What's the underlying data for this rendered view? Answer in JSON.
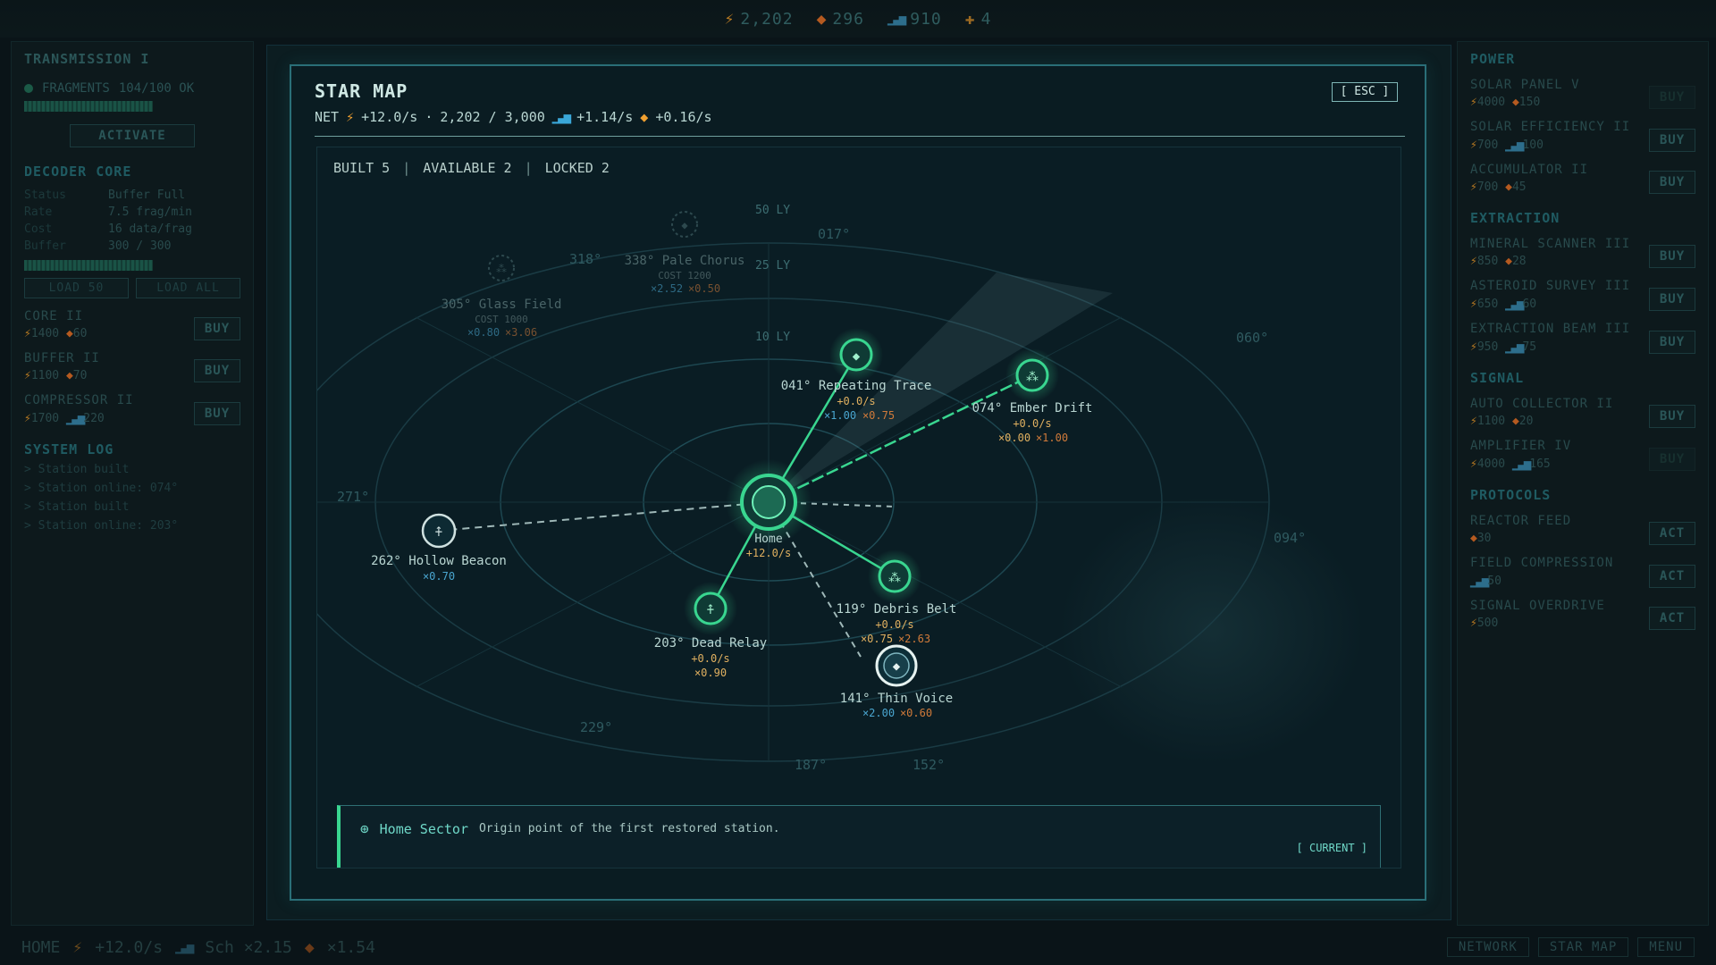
{
  "topbar": {
    "energy": "2,202",
    "minerals": "296",
    "signal": "910",
    "fragments": "4"
  },
  "left": {
    "title": "TRANSMISSION I",
    "fragments_label": "FRAGMENTS",
    "fragments_value": "104/100 OK",
    "activate": "ACTIVATE",
    "decoder_title": "DECODER CORE",
    "decoder": [
      {
        "k": "Status",
        "v": "Buffer Full"
      },
      {
        "k": "Rate",
        "v": "7.5 frag/min"
      },
      {
        "k": "Cost",
        "v": "16 data/frag"
      },
      {
        "k": "Buffer",
        "v": "300 / 300"
      }
    ],
    "load50": "LOAD 50",
    "loadall": "LOAD ALL",
    "shop": [
      {
        "name": "CORE II",
        "c1": "1400",
        "c2": "60",
        "buy": "BUY"
      },
      {
        "name": "BUFFER II",
        "c1": "1100",
        "c2": "70",
        "buy": "BUY"
      },
      {
        "name": "COMPRESSOR II",
        "c1": "1700",
        "c2": "220",
        "buy": "BUY"
      }
    ],
    "log_title": "SYSTEM LOG",
    "log": [
      "> Station built",
      "> Station online: 074°",
      "> Station built",
      "> Station online: 203°"
    ]
  },
  "right": {
    "power_title": "POWER",
    "power": [
      {
        "name": "SOLAR PANEL V",
        "c1": "4000",
        "c2": "150",
        "buy": "BUY",
        "disabled": true
      },
      {
        "name": "SOLAR EFFICIENCY II",
        "c1": "700",
        "c2": "100",
        "buy": "BUY",
        "disabled": false
      },
      {
        "name": "ACCUMULATOR II",
        "c1": "700",
        "c2": "45",
        "buy": "BUY",
        "disabled": false
      }
    ],
    "extraction_title": "EXTRACTION",
    "extraction": [
      {
        "name": "MINERAL SCANNER III",
        "c1": "850",
        "c2": "28",
        "buy": "BUY"
      },
      {
        "name": "ASTEROID SURVEY III",
        "c1": "650",
        "c2": "60",
        "buy": "BUY"
      },
      {
        "name": "EXTRACTION BEAM III",
        "c1": "950",
        "c2": "75",
        "buy": "BUY"
      }
    ],
    "signal_title": "SIGNAL",
    "signal": [
      {
        "name": "AUTO COLLECTOR II",
        "c1": "1100",
        "c2": "20",
        "buy": "BUY",
        "disabled": false
      },
      {
        "name": "AMPLIFIER IV",
        "c1": "4000",
        "c2": "165",
        "buy": "BUY",
        "disabled": true
      }
    ],
    "protocols_title": "PROTOCOLS",
    "protocols": [
      {
        "name": "REACTOR FEED",
        "cost": "30",
        "act": "ACT"
      },
      {
        "name": "FIELD COMPRESSION",
        "cost": "50",
        "act": "ACT"
      },
      {
        "name": "SIGNAL OVERDRIVE",
        "cost": "500",
        "act": "ACT"
      }
    ]
  },
  "bottom": {
    "home": "HOME",
    "rate": "+12.0/s",
    "sch": "Sch ×2.15",
    "mult": "×1.54",
    "tabs": [
      "NETWORK",
      "STAR MAP",
      "MENU"
    ]
  },
  "modal": {
    "title": "STAR MAP",
    "esc": "[ ESC ]",
    "net_label": "NET",
    "net_rate": "+12.0/s",
    "dot": "·",
    "energy": "2,202 / 3,000",
    "signal_rate": "+1.14/s",
    "mineral_rate": "+0.16/s",
    "built": "BUILT 5",
    "available": "AVAILABLE 2",
    "locked": "LOCKED 2",
    "sep": "|",
    "info_title": "Home Sector",
    "info_desc": "Origin point of the first restored station.",
    "info_status": "[ CURRENT ]"
  },
  "map": {
    "ring_labels": {
      "r50": "50 LY",
      "r25": "25 LY",
      "r10": "10 LY"
    },
    "bearings": [
      "017°",
      "060°",
      "094°",
      "152°",
      "187°",
      "229°",
      "271°",
      "318°"
    ],
    "home": {
      "name": "Home",
      "rate": "+12.0/s"
    },
    "stations": {
      "repeating": {
        "name": "041° Repeating Trace",
        "rate": "+0.0/s",
        "m1": "×1.00",
        "m2": "×0.75"
      },
      "ember": {
        "name": "074° Ember Drift",
        "rate": "+0.0/s",
        "m1": "×0.00",
        "m2": "×1.00"
      },
      "debris": {
        "name": "119° Debris Belt",
        "rate": "+0.0/s",
        "m1": "×0.75",
        "m2": "×2.63"
      },
      "dead": {
        "name": "203° Dead Relay",
        "rate": "+0.0/s",
        "m1": "×0.90"
      },
      "thin": {
        "name": "141° Thin Voice",
        "m1": "×2.00",
        "m2": "×0.60"
      },
      "hollow": {
        "name": "262° Hollow Beacon",
        "m1": "×0.70"
      },
      "glass": {
        "name": "305° Glass Field",
        "cost": "COST 1000",
        "m1": "×0.80",
        "m2": "×3.06"
      },
      "pale": {
        "name": "338° Pale Chorus",
        "cost": "COST 1200",
        "m1": "×2.52",
        "m2": "×0.50"
      }
    }
  },
  "colors": {
    "accent": "#39d690",
    "frame": "#2a6f78",
    "energy": "#f0a030",
    "signal": "#3aa7d8"
  }
}
